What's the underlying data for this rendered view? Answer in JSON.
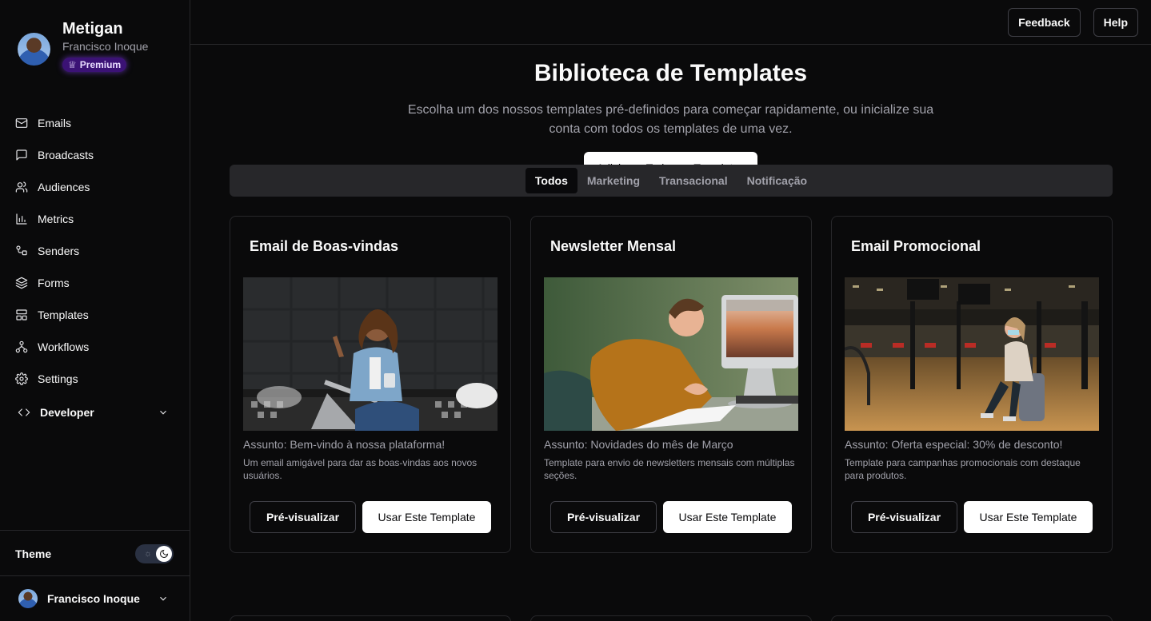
{
  "sidebar": {
    "app_name": "Metigan",
    "user_name": "Francisco Inoque",
    "badge": "Premium",
    "nav": [
      {
        "label": "Emails",
        "icon": "mail-icon"
      },
      {
        "label": "Broadcasts",
        "icon": "message-square-icon"
      },
      {
        "label": "Audiences",
        "icon": "users-icon"
      },
      {
        "label": "Metrics",
        "icon": "bar-chart-icon"
      },
      {
        "label": "Senders",
        "icon": "senders-icon"
      },
      {
        "label": "Forms",
        "icon": "layers-icon"
      },
      {
        "label": "Templates",
        "icon": "templates-icon"
      },
      {
        "label": "Workflows",
        "icon": "workflow-icon"
      },
      {
        "label": "Settings",
        "icon": "gear-icon"
      }
    ],
    "developer_label": "Developer",
    "theme_label": "Theme",
    "footer_user": "Francisco Inoque"
  },
  "topbar": {
    "feedback": "Feedback",
    "help": "Help"
  },
  "hero": {
    "title": "Biblioteca de Templates",
    "subtitle": "Escolha um dos nossos templates pré-definidos para começar rapidamente, ou inicialize sua conta com todos os templates de uma vez.",
    "add_all": "Adicionar Todos os Templates"
  },
  "tabs": [
    {
      "label": "Todos",
      "active": true
    },
    {
      "label": "Marketing",
      "active": false
    },
    {
      "label": "Transacional",
      "active": false
    },
    {
      "label": "Notificação",
      "active": false
    }
  ],
  "cards": [
    {
      "title": "Email de Boas-vindas",
      "subject": "Assunto: Bem-vindo à nossa plataforma!",
      "description": "Um email amigável para dar as boas-vindas aos novos usuários.",
      "preview": "Pré-visualizar",
      "use": "Usar Este Template"
    },
    {
      "title": "Newsletter Mensal",
      "subject": "Assunto: Novidades do mês de Março",
      "description": "Template para envio de newsletters mensais com múltiplas seções.",
      "preview": "Pré-visualizar",
      "use": "Usar Este Template"
    },
    {
      "title": "Email Promocional",
      "subject": "Assunto: Oferta especial: 30% de desconto!",
      "description": "Template para campanhas promocionais com destaque para produtos.",
      "preview": "Pré-visualizar",
      "use": "Usar Este Template"
    }
  ],
  "colors": {
    "background": "#0a0a0b",
    "border": "#27272a",
    "muted_text": "#a1a1aa",
    "premium": "#3b1275"
  }
}
